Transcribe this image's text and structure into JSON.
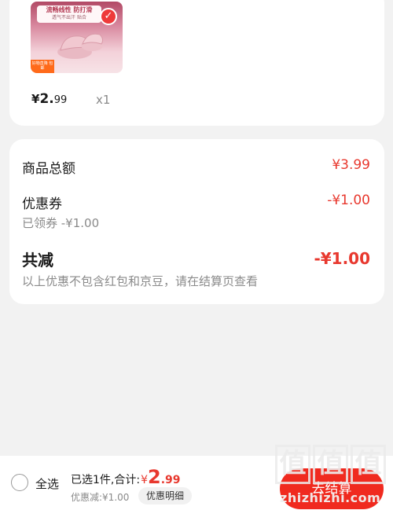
{
  "product": {
    "image_banner_title": "流畅线性 防打滑",
    "image_banner_sub": "透气不出汗 贴合",
    "image_tag": "好物直降 包邮",
    "price_symbol": "¥",
    "price_int": "2.",
    "price_dec": "99",
    "quantity": "x1"
  },
  "summary": {
    "goods_total_label": "商品总额",
    "goods_total_value": "¥3.99",
    "coupon_label": "优惠券",
    "coupon_value": "-¥1.00",
    "coupon_sub": "已领券 -¥1.00",
    "total_reduce_label": "共减",
    "total_reduce_value": "-¥1.00",
    "note": "以上优惠不包含红包和京豆，请在结算页查看"
  },
  "bottom_bar": {
    "select_all_label": "全选",
    "selected_text": "已选1件,合计:",
    "total_symbol": "¥",
    "total_int": "2",
    "total_dec": ".99",
    "discount_text": "优惠减:¥1.00",
    "detail_button": "优惠明细",
    "checkout_button": "去结算"
  },
  "watermark": {
    "logo_chars": [
      "值",
      "值",
      "值"
    ],
    "site": "zhizhizhi.com"
  },
  "colors": {
    "accent_red": "#e8382e",
    "checkout_red": "#f02a1f",
    "background": "#f2f2f2"
  }
}
